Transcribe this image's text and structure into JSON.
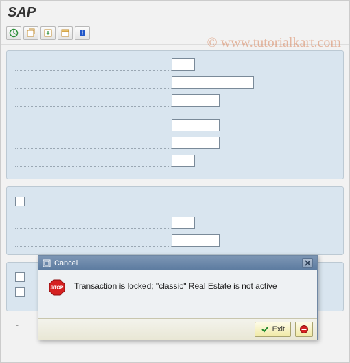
{
  "app": {
    "title": "SAP"
  },
  "watermark": "© www.tutorialkart.com",
  "toolbar": {
    "icons": [
      "execute-icon",
      "get-variant-icon",
      "import-icon",
      "variant-icon",
      "info-icon"
    ]
  },
  "panel1": {
    "rows": [
      {
        "value": "",
        "size": "w-small"
      },
      {
        "value": "",
        "size": "w-large"
      },
      {
        "value": "",
        "size": "w-med"
      }
    ],
    "rows2": [
      {
        "value": "",
        "size": "w-med"
      },
      {
        "value": "",
        "size": "w-med"
      },
      {
        "value": "",
        "size": "w-small"
      }
    ]
  },
  "panel2": {
    "check1": false,
    "rows": [
      {
        "value": "",
        "size": "w-small"
      },
      {
        "value": "",
        "size": "w-med"
      }
    ]
  },
  "panel3": {
    "check1": false,
    "check2": false
  },
  "dash": "-",
  "modal": {
    "title": "Cancel",
    "message": "Transaction is locked; \"classic\" Real Estate is not active",
    "exit_label": "Exit"
  }
}
